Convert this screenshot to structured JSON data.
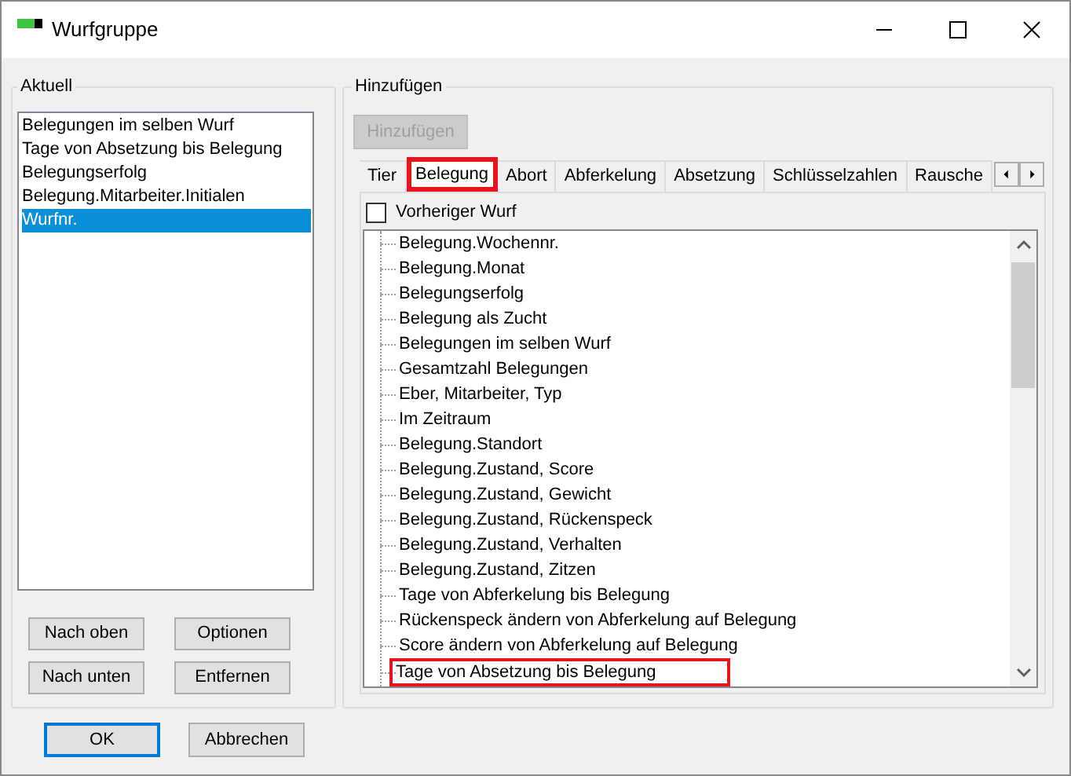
{
  "window": {
    "title": "Wurfgruppe"
  },
  "current": {
    "label": "Aktuell",
    "items": [
      {
        "text": "Belegungen im selben Wurf",
        "selected": false
      },
      {
        "text": "Tage von Absetzung bis Belegung",
        "selected": false
      },
      {
        "text": "Belegungserfolg",
        "selected": false
      },
      {
        "text": "Belegung.Mitarbeiter.Initialen",
        "selected": false
      },
      {
        "text": "Wurfnr.",
        "selected": true
      }
    ],
    "buttons": [
      "Nach oben",
      "Optionen",
      "Nach unten",
      "Entfernen"
    ]
  },
  "add": {
    "label": "Hinzufügen",
    "button": {
      "label": "Hinzufügen",
      "disabled": true
    },
    "tabs": [
      {
        "label": "Tier",
        "selected": false,
        "highlighted": false
      },
      {
        "label": "Belegung",
        "selected": true,
        "highlighted": true
      },
      {
        "label": "Abort",
        "selected": false,
        "highlighted": false
      },
      {
        "label": "Abferkelung",
        "selected": false,
        "highlighted": false
      },
      {
        "label": "Absetzung",
        "selected": false,
        "highlighted": false
      },
      {
        "label": "Schlüsselzahlen",
        "selected": false,
        "highlighted": false
      },
      {
        "label": "Rausche",
        "selected": false,
        "highlighted": false
      }
    ],
    "checkbox": {
      "label": "Vorheriger Wurf",
      "checked": false
    },
    "tree": [
      {
        "text": "Belegung.Wochennr.",
        "highlighted": false
      },
      {
        "text": "Belegung.Monat",
        "highlighted": false
      },
      {
        "text": "Belegungserfolg",
        "highlighted": false
      },
      {
        "text": "Belegung als Zucht",
        "highlighted": false
      },
      {
        "text": "Belegungen im selben Wurf",
        "highlighted": false
      },
      {
        "text": "Gesamtzahl Belegungen",
        "highlighted": false
      },
      {
        "text": "Eber, Mitarbeiter, Typ",
        "highlighted": false
      },
      {
        "text": "Im Zeitraum",
        "highlighted": false
      },
      {
        "text": "Belegung.Standort",
        "highlighted": false
      },
      {
        "text": "Belegung.Zustand, Score",
        "highlighted": false
      },
      {
        "text": "Belegung.Zustand, Gewicht",
        "highlighted": false
      },
      {
        "text": "Belegung.Zustand, Rückenspeck",
        "highlighted": false
      },
      {
        "text": "Belegung.Zustand, Verhalten",
        "highlighted": false
      },
      {
        "text": "Belegung.Zustand, Zitzen",
        "highlighted": false
      },
      {
        "text": "Tage von Abferkelung bis Belegung",
        "highlighted": false
      },
      {
        "text": "Rückenspeck ändern von Abferkelung auf Belegung",
        "highlighted": false
      },
      {
        "text": "Score ändern von Abferkelung auf Belegung",
        "highlighted": false
      },
      {
        "text": "Tage von Absetzung bis Belegung",
        "highlighted": true
      }
    ]
  },
  "footer": {
    "buttons": [
      {
        "label": "OK",
        "default": true
      },
      {
        "label": "Abbrechen",
        "default": false
      }
    ]
  }
}
